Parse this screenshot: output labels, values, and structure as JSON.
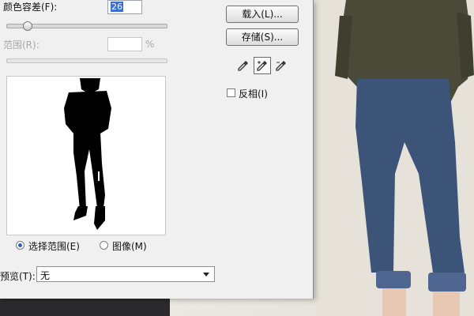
{
  "dialog": {
    "fuzziness_label": "颜色容差(F):",
    "fuzziness_value": "26",
    "fuzziness_level": 0.13,
    "range_label": "范围(R):",
    "range_value": "",
    "range_unit": "%",
    "load_button": "载入(L)...",
    "save_button": "存储(S)...",
    "invert_label": "反相(I)",
    "invert_checked": false,
    "radio_selection_label": "选择范围(E)",
    "radio_image_label": "图像(M)",
    "selected_radio": "selection",
    "preview_label": "预览(T):",
    "preview_value": "无"
  },
  "icons": [
    "eyedropper-icon",
    "eyedropper-plus-icon",
    "eyedropper-minus-icon",
    "dropdown-arrow-icon"
  ]
}
